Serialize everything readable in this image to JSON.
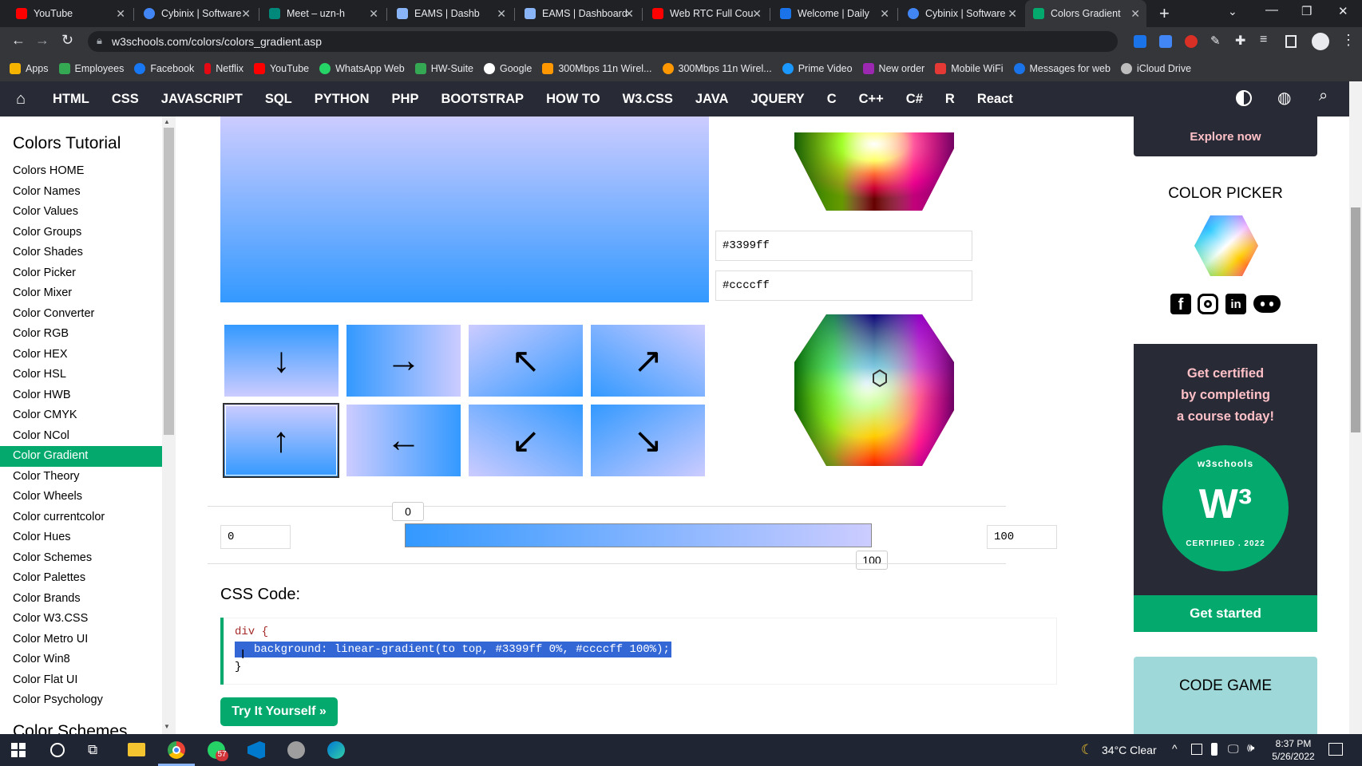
{
  "browser": {
    "tabs": [
      {
        "label": "YouTube",
        "color": "#ff0000"
      },
      {
        "label": "Cybinix | Software",
        "color": "#4285f4"
      },
      {
        "label": "Meet – uzn-h",
        "color": "#00897b"
      },
      {
        "label": "EAMS | Dashb",
        "color": "#5f6368"
      },
      {
        "label": "EAMS | Dashboard",
        "color": "#5f6368"
      },
      {
        "label": "Web RTC Full Cou",
        "color": "#ff0000"
      },
      {
        "label": "Welcome | Daily",
        "color": "#1a73e8"
      },
      {
        "label": "Cybinix | Software",
        "color": "#4285f4"
      },
      {
        "label": "Colors Gradient",
        "color": "#04aa6d"
      }
    ],
    "url": "w3schools.com/colors/colors_gradient.asp",
    "bookmarks": [
      {
        "label": "Apps",
        "color": "#f4b400"
      },
      {
        "label": "Employees",
        "color": "#34a853"
      },
      {
        "label": "Facebook",
        "color": "#1877f2"
      },
      {
        "label": "Netflix",
        "color": "#e50914"
      },
      {
        "label": "YouTube",
        "color": "#ff0000"
      },
      {
        "label": "WhatsApp Web",
        "color": "#25d366"
      },
      {
        "label": "HW-Suite",
        "color": "#34a853"
      },
      {
        "label": "Google",
        "color": "#ffffff"
      },
      {
        "label": "300Mbps 11n Wirel...",
        "color": "#ff9800"
      },
      {
        "label": "300Mbps 11n Wirel...",
        "color": "#ff9800"
      },
      {
        "label": "Prime Video",
        "color": "#1a98ff"
      },
      {
        "label": "New order",
        "color": "#9c27b0"
      },
      {
        "label": "Mobile WiFi",
        "color": "#e53935"
      },
      {
        "label": "Messages for web",
        "color": "#1a73e8"
      },
      {
        "label": "iCloud Drive",
        "color": "#bdbdbd"
      }
    ]
  },
  "nav": {
    "items": [
      "HTML",
      "CSS",
      "JAVASCRIPT",
      "SQL",
      "PYTHON",
      "PHP",
      "BOOTSTRAP",
      "HOW TO",
      "W3.CSS",
      "JAVA",
      "JQUERY",
      "C",
      "C++",
      "C#",
      "R",
      "React"
    ]
  },
  "sidebar": {
    "title": "Colors Tutorial",
    "items": [
      "Colors HOME",
      "Color Names",
      "Color Values",
      "Color Groups",
      "Color Shades",
      "Color Picker",
      "Color Mixer",
      "Color Converter",
      "Color RGB",
      "Color HEX",
      "Color HSL",
      "Color HWB",
      "Color CMYK",
      "Color NCol",
      "Color Gradient",
      "Color Theory",
      "Color Wheels",
      "Color currentcolor",
      "Color Hues",
      "Color Schemes",
      "Color Palettes",
      "Color Brands",
      "Color W3.CSS",
      "Color Metro UI",
      "Color Win8",
      "Color Flat UI",
      "Color Psychology"
    ],
    "active": "Color Gradient",
    "next_heading": "Color Schemes"
  },
  "main": {
    "color1": "#3399ff",
    "color2": "#ccccff",
    "directions": [
      "↓",
      "→",
      "↖",
      "↗",
      "↑",
      "←",
      "↙",
      "↘"
    ],
    "stop_start_input": "0",
    "stop_end_input": "100",
    "stop_start_tip": "0",
    "stop_end_tip": "100",
    "css_heading": "CSS Code:",
    "code_line1": "div {",
    "code_line2": "background: linear-gradient(to top, #3399ff 0%, #ccccff 100%);",
    "code_line3": "}",
    "try_button": "Try It Yourself »"
  },
  "right": {
    "explore": "Explore now",
    "color_picker": "COLOR PICKER",
    "cert_text_1": "Get certified",
    "cert_text_2": "by completing",
    "cert_text_3": "a course today!",
    "badge_top": "w3schools",
    "badge_bottom": "CERTIFIED . 2022",
    "get_started": "Get started",
    "code_game": "CODE GAME"
  },
  "taskbar": {
    "weather": "34°C  Clear",
    "time": "8:37 PM",
    "date": "5/26/2022",
    "whatsapp_badge": "57"
  }
}
